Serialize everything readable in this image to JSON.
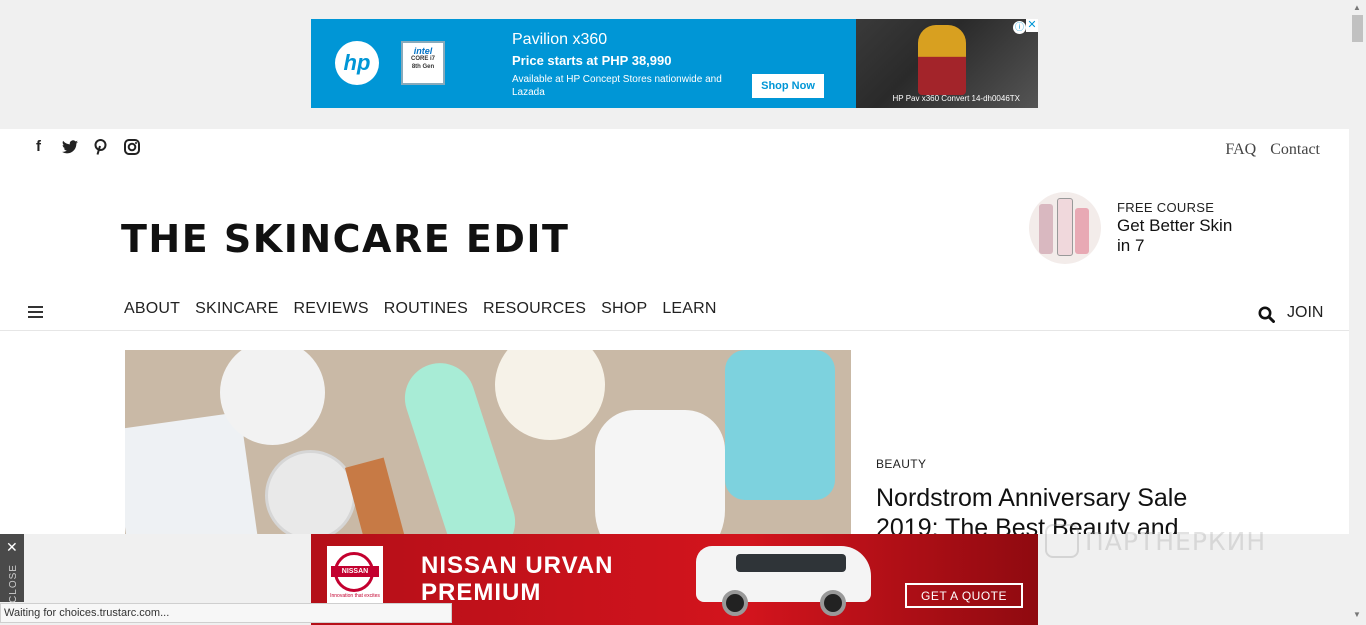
{
  "top_ad": {
    "title": "Pavilion x360",
    "price": "Price starts at PHP 38,990",
    "availability": "Available at HP Concept Stores nationwide and Lazada",
    "cta": "Shop Now",
    "caption": "HP Pav x360 Convert 14-dh0046TX",
    "brand": "hp",
    "badge_brand": "intel",
    "badge_line1": "CORE i7",
    "badge_line2": "8th Gen",
    "color": "#0096d6"
  },
  "header": {
    "social_icons": [
      "facebook-icon",
      "twitter-icon",
      "pinterest-icon",
      "instagram-icon"
    ],
    "links": [
      "FAQ",
      "Contact"
    ],
    "logo": "THE SKINCARE EDIT"
  },
  "promo": {
    "label": "FREE COURSE",
    "headline": "Get Better Skin in 7"
  },
  "nav": {
    "items": [
      "ABOUT",
      "SKINCARE",
      "REVIEWS",
      "ROUTINES",
      "RESOURCES",
      "SHOP",
      "LEARN"
    ],
    "join": "JOIN"
  },
  "article": {
    "category": "BEAUTY",
    "title": "Nordstrom Anniversary Sale 2019: The Best Beauty and"
  },
  "bottom_ad": {
    "brand": "NISSAN",
    "tagline": "Innovation that excites",
    "headline_line1": "NISSAN URVAN",
    "headline_line2": "PREMIUM",
    "cta": "GET A QUOTE",
    "close": "CLOSE"
  },
  "watermark": "ПАРТНЕРКИН",
  "status": "Waiting for choices.trustarc.com..."
}
